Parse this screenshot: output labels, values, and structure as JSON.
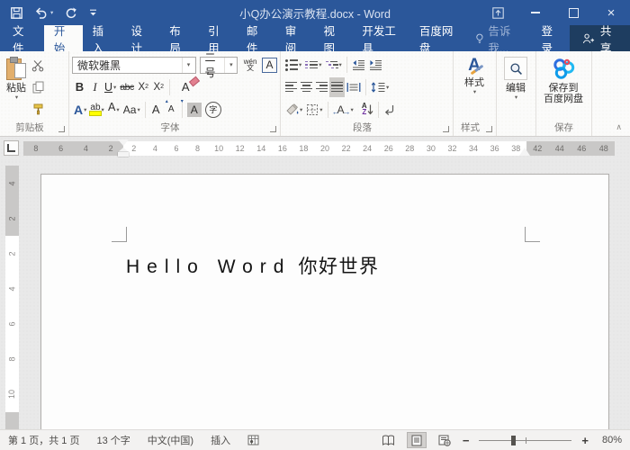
{
  "window": {
    "title": "小Q办公演示教程.docx - Word"
  },
  "tabs": [
    "文件",
    "开始",
    "插入",
    "设计",
    "布局",
    "引用",
    "邮件",
    "审阅",
    "视图",
    "开发工具",
    "百度网盘"
  ],
  "top_right": {
    "tell_me": "告诉我...",
    "sign_in": "登录",
    "share": "共享"
  },
  "ribbon": {
    "clipboard": {
      "paste": "粘贴",
      "label": "剪贴板"
    },
    "font": {
      "label": "字体",
      "font_name": "微软雅黑",
      "font_size": "二号",
      "phonetic_top": "wén",
      "phonetic_bottom": "文",
      "char_border": "A",
      "bold": "B",
      "italic": "I",
      "underline": "U",
      "strikethrough": "abc",
      "subscript_base": "X",
      "subscript_mark": "2",
      "superscript_base": "X",
      "superscript_mark": "2",
      "clear_format": "A",
      "text_effects": "A",
      "highlight": "ab",
      "font_color": "A",
      "change_case": "Aa",
      "grow_font": "A",
      "shrink_font": "A",
      "char_shading": "A",
      "enclose_char": "字"
    },
    "paragraph": {
      "label": "段落",
      "sort_a": "A",
      "sort_z": "Z",
      "asian_a": "A"
    },
    "styles": {
      "button": "样式",
      "label": "样式",
      "icon_letter": "A"
    },
    "editing": {
      "button": "编辑"
    },
    "baidu_save": {
      "line1": "保存到",
      "line2": "百度网盘",
      "label": "保存"
    }
  },
  "ruler": {
    "h_margin_left": [
      "8",
      "6",
      "4",
      "2"
    ],
    "h_text": [
      "2",
      "4",
      "6",
      "8",
      "10",
      "12",
      "14",
      "16",
      "18",
      "20",
      "22",
      "24",
      "26",
      "28",
      "30",
      "32",
      "34",
      "36",
      "38"
    ],
    "h_margin_right": [
      "42",
      "44",
      "46",
      "48"
    ],
    "v_margin_top": [
      "4",
      "2"
    ],
    "v_text": [
      "2",
      "4",
      "6",
      "8",
      "10"
    ]
  },
  "document": {
    "text_latin": "Hello Word",
    "text_cjk": "你好世界"
  },
  "statusbar": {
    "page_info": "第 1 页，共 1 页",
    "word_count": "13 个字",
    "language": "中文(中国)",
    "insert_mode": "插入",
    "zoom_out": "−",
    "zoom_in": "+",
    "zoom_level": "80%"
  }
}
